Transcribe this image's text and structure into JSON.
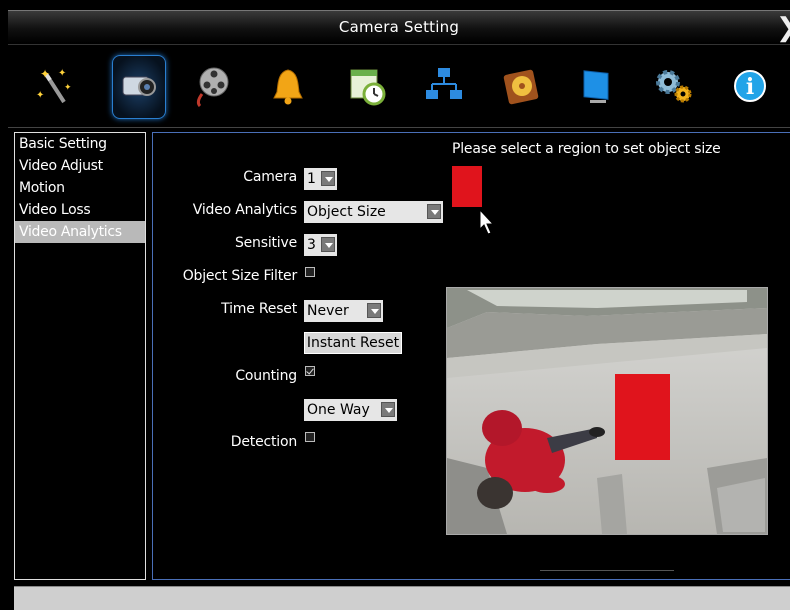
{
  "window": {
    "title": "Camera Setting",
    "close_glyph": "❯"
  },
  "toolbar": {
    "items": [
      {
        "name": "wizard-icon",
        "active": false
      },
      {
        "name": "camera-icon",
        "active": true
      },
      {
        "name": "film-reel-icon",
        "active": false
      },
      {
        "name": "alarm-bell-icon",
        "active": false
      },
      {
        "name": "schedule-icon",
        "active": false
      },
      {
        "name": "network-icon",
        "active": false
      },
      {
        "name": "storage-disk-icon",
        "active": false
      },
      {
        "name": "monitor-icon",
        "active": false
      },
      {
        "name": "system-gears-icon",
        "active": false
      },
      {
        "name": "info-icon",
        "active": false
      }
    ]
  },
  "sidebar": {
    "items": [
      {
        "label": "Basic Setting",
        "active": false
      },
      {
        "label": "Video Adjust",
        "active": false
      },
      {
        "label": "Motion",
        "active": false
      },
      {
        "label": "Video Loss",
        "active": false
      },
      {
        "label": "Video Analytics",
        "active": true
      }
    ]
  },
  "form": {
    "camera_label": "Camera",
    "camera_value": "1",
    "analytics_label": "Video Analytics",
    "analytics_value": "Object Size",
    "sensitive_label": "Sensitive",
    "sensitive_value": "3",
    "object_size_filter_label": "Object Size Filter",
    "object_size_filter_checked": false,
    "time_reset_label": "Time Reset",
    "time_reset_value": "Never",
    "instant_reset_label": "Instant Reset",
    "counting_label": "Counting",
    "counting_checked": true,
    "direction_value": "One Way",
    "detection_label": "Detection",
    "detection_checked": false
  },
  "region": {
    "hint": "Please select a region to set object size",
    "color": "#e0141c"
  },
  "colors": {
    "accent": "#2a7fd0",
    "panel_border": "#4a6fb8",
    "highlight": "#b9b9b9"
  }
}
